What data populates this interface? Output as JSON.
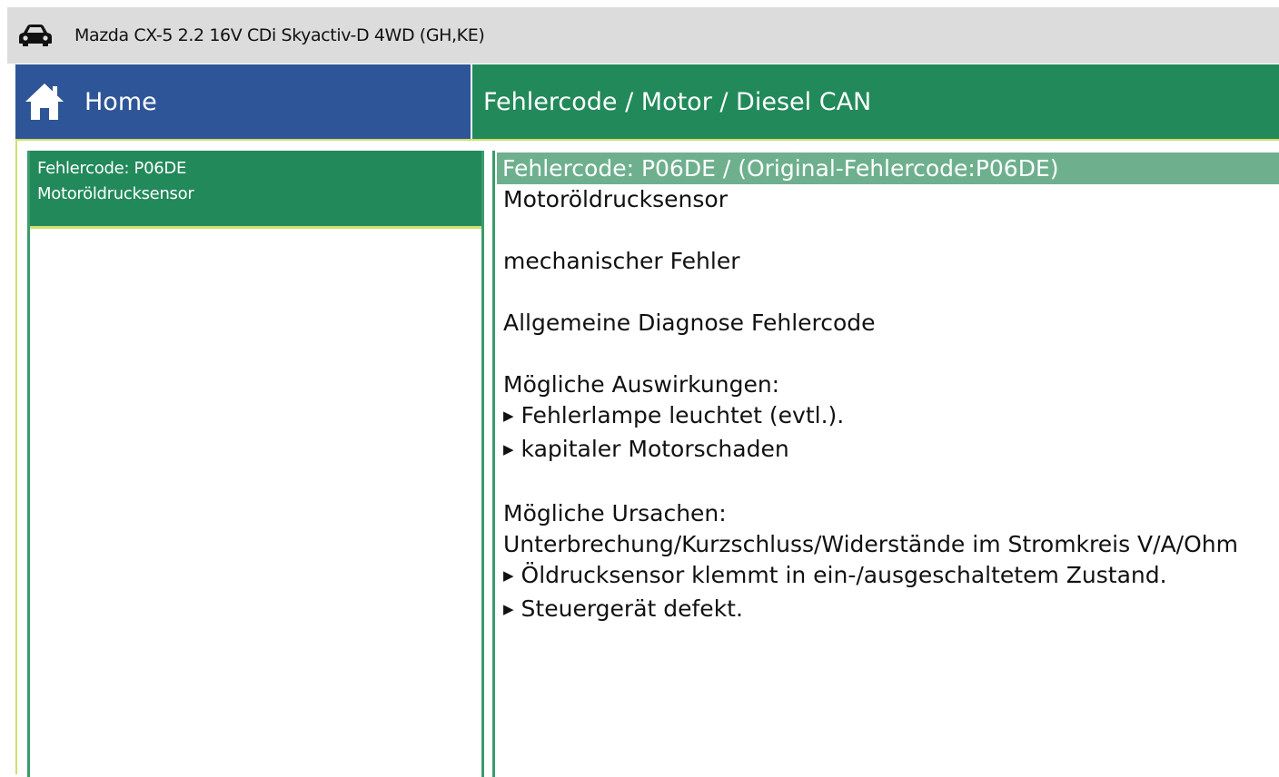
{
  "titlebar": {
    "vehicle": "Mazda CX-5 2.2 16V CDi Skyactiv-D 4WD (GH,KE)",
    "icon": "car-icon"
  },
  "nav": {
    "home_label": "Home",
    "home_icon": "home-icon",
    "breadcrumb": "Fehlercode / Motor / Diesel CAN"
  },
  "fault_list": {
    "selected": {
      "code": "Fehlercode: P06DE",
      "name": "Motoröldrucksensor"
    }
  },
  "detail": {
    "header": "Fehlercode: P06DE / (Original-Fehlercode:P06DE)",
    "title": "Motoröldrucksensor",
    "type": "mechanischer Fehler",
    "category": "Allgemeine Diagnose Fehlercode",
    "effects_heading": "Mögliche Auswirkungen:",
    "effects": [
      "Fehlerlampe leuchtet (evtl.).",
      "kapitaler Motorschaden"
    ],
    "causes_heading": "Mögliche Ursachen:",
    "causes_intro": "Unterbrechung/Kurzschluss/Widerstände im Stromkreis V/A/Ohm",
    "causes": [
      "Öldrucksensor klemmt in ein-/ausgeschaltetem Zustand.",
      "Steuergerät defekt."
    ]
  },
  "colors": {
    "titlebar_bg": "#dcdcdc",
    "home_bg": "#2e5597",
    "breadcrumb_bg": "#22895a",
    "selected_bg": "#22895a",
    "detail_header_bg": "#6eb08e",
    "frame_accent": "#cfe06a"
  }
}
